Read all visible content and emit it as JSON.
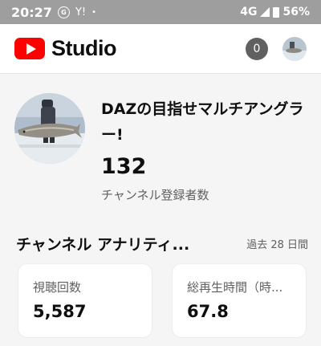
{
  "status_bar": {
    "time": "20:27",
    "icons": [
      "notification-circle-icon",
      "y-icon",
      "dot-icon"
    ],
    "notification_glyph": "G",
    "y_glyph": "Y!",
    "dot_glyph": "•",
    "network": "4G",
    "battery": "56%"
  },
  "header": {
    "logo_text": "Studio",
    "notifications": "0",
    "brand_color": "#ff0000"
  },
  "channel": {
    "name": "DAZの目指せマルチアングラー!",
    "subscriber_count": "132",
    "subscriber_label": "チャンネル登録者数"
  },
  "analytics": {
    "title": "チャンネル アナリティ...",
    "period": "過去 28 日間",
    "cards": [
      {
        "label": "視聴回数",
        "value": "5,587"
      },
      {
        "label": "総再生時間（時...",
        "value": "67.8"
      }
    ]
  }
}
